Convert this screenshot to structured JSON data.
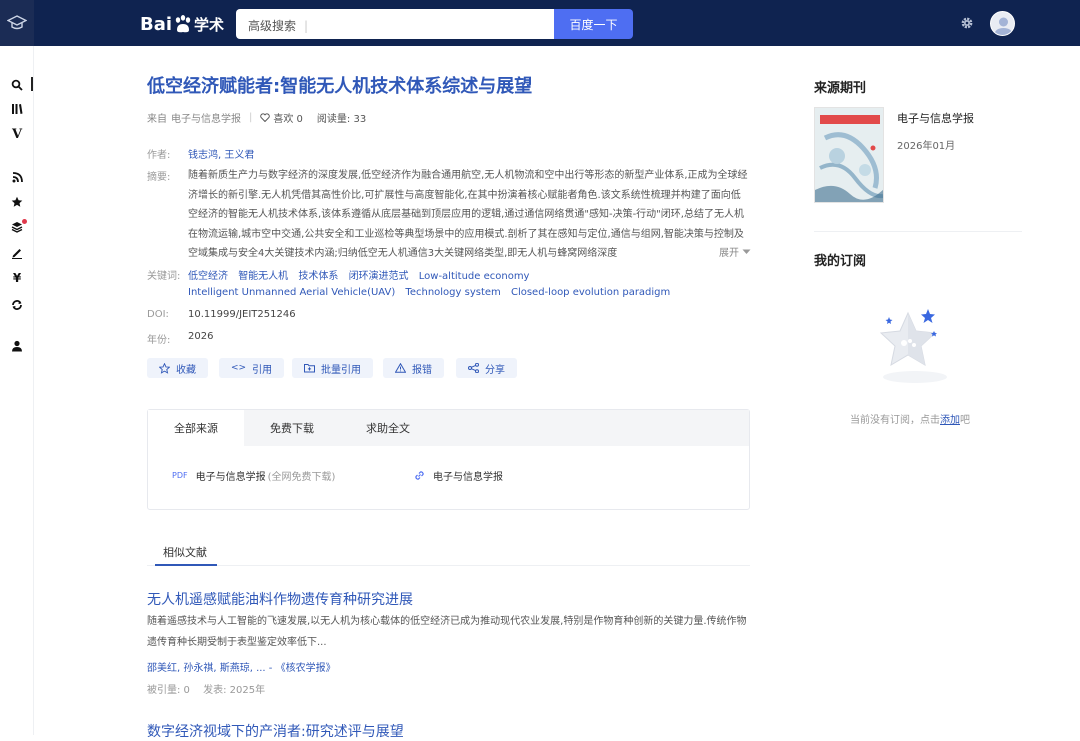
{
  "header": {
    "logo_bai": "Bai",
    "logo_xueshu": "学术",
    "search_placeholder": "高级搜索",
    "search_button": "百度一下"
  },
  "sidebar": {
    "items": [
      "search-icon",
      "library-icon",
      "v-icon",
      "rss-icon",
      "star-icon",
      "layers-icon",
      "edit-icon",
      "yen-icon",
      "refresh-icon",
      "user-icon"
    ]
  },
  "paper": {
    "title": "低空经济赋能者:智能无人机技术体系综述与展望",
    "source_prefix": "来自",
    "source": "电子与信息学报",
    "likes": "喜欢 0",
    "reads": "阅读量: 33",
    "author_label": "作者:",
    "authors": "钱志鸿, 王义君",
    "abstract_label": "摘要:",
    "abstract": "随着新质生产力与数字经济的深度发展,低空经济作为融合通用航空,无人机物流和空中出行等形态的新型产业体系,正成为全球经济增长的新引擎.无人机凭借其高性价比,可扩展性与高度智能化,在其中扮演着核心赋能者角色.该文系统性梳理并构建了面向低空经济的智能无人机技术体系,该体系遵循从底层基础到顶层应用的逻辑,通过通信网络贯通\"感知-决策-行动\"闭环,总结了无人机在物流运输,城市空中交通,公共安全和工业巡检等典型场景中的应用模式.剖析了其在感知与定位,通信与组网,智能决策与控制及空域集成与安全4大关键技术内涵;归纳低空无人机通信3大关键网络类型,即无人机与蜂窝网络深度",
    "expand": "展开",
    "keyword_label": "关键词:",
    "keywords": [
      "低空经济",
      "智能无人机",
      "技术体系",
      "闭环演进范式",
      "Low-altitude economy",
      "Intelligent Unmanned Aerial Vehicle(UAV)",
      "Technology system",
      "Closed-loop evolution paradigm"
    ],
    "doi_label": "DOI:",
    "doi": "10.11999/JEIT251246",
    "year_label": "年份:",
    "year": "2026"
  },
  "actions": [
    "收藏",
    "引用",
    "批量引用",
    "报错",
    "分享"
  ],
  "sources": {
    "tabs": [
      "全部来源",
      "免费下载",
      "求助全文"
    ],
    "items": [
      {
        "type": "PDF",
        "name": "电子与信息学报",
        "note": "(全网免费下载)"
      },
      {
        "type": "link",
        "name": "电子与信息学报",
        "note": ""
      }
    ]
  },
  "similar": {
    "tab_label": "相似文献",
    "articles": [
      {
        "title": "无人机遥感赋能油料作物遗传育种研究进展",
        "abstract": "随着遥感技术与人工智能的飞速发展,以无人机为核心载体的低空经济已成为推动现代农业发展,特别是作物育种创新的关键力量.传统作物遗传育种长期受制于表型鉴定效率低下...",
        "authors": "邵美红, 孙永祺, 斯燕琼, ... - 《核农学报》",
        "cited": "被引量: 0",
        "published": "发表: 2025年"
      },
      {
        "title": "数字经济视域下的产消者:研究述评与展望"
      }
    ]
  },
  "right_panel": {
    "journal_heading": "来源期刊",
    "journal_name": "电子与信息学报",
    "journal_date": "2026年01月",
    "subscription_heading": "我的订阅",
    "empty_text": "当前没有订阅，点击",
    "empty_link": "添加",
    "empty_suffix": "吧"
  },
  "colors": {
    "header_bg": "#0f2350",
    "accent": "#4e6ef2",
    "link": "#3058b8"
  }
}
